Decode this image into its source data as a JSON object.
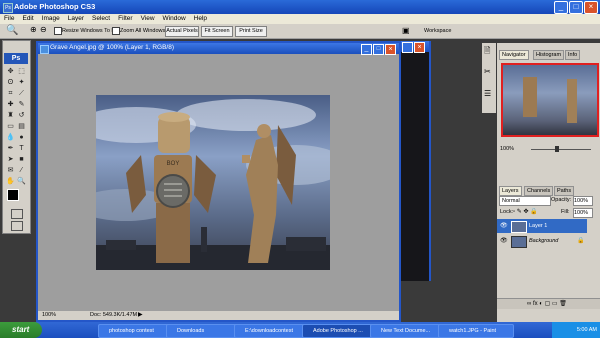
{
  "app": {
    "title": "Adobe Photoshop CS3"
  },
  "menu": [
    "File",
    "Edit",
    "Image",
    "Layer",
    "Select",
    "Filter",
    "View",
    "Window",
    "Help"
  ],
  "options": {
    "resize_label": "Resize Windows To Fit",
    "zoom_all_label": "Zoom All Windows",
    "actual_pixels": "Actual Pixels",
    "fit_screen": "Fit Screen",
    "print_size": "Print Size",
    "workspace": "Workspace"
  },
  "document": {
    "title": "Grave Angel.jpg @ 100% (Layer 1, RGB/8)",
    "zoom": "100%",
    "doc_info": "Doc: 549.3K/1.47M",
    "sign_text": "BOY"
  },
  "toolbox": {
    "ps_label": "Ps"
  },
  "navigator": {
    "tabs": [
      "Navigator",
      "Histogram",
      "Info"
    ],
    "zoom": "100%"
  },
  "layers": {
    "tabs": [
      "Layers",
      "Channels",
      "Paths"
    ],
    "blend_mode": "Normal",
    "opacity_label": "Opacity:",
    "opacity_value": "100%",
    "lock_label": "Lock:",
    "fill_label": "Fill:",
    "fill_value": "100%",
    "items": [
      {
        "name": "Layer 1",
        "selected": true
      },
      {
        "name": "Background",
        "selected": false
      }
    ]
  },
  "taskbar": {
    "start": "start",
    "tasks": [
      "photoshop contest",
      "Downloads",
      "E:\\downloadcontest",
      "Adobe Photoshop ...",
      "New Text Docume...",
      "watch1.JPG - Paint"
    ],
    "clock": "5:00 AM"
  }
}
